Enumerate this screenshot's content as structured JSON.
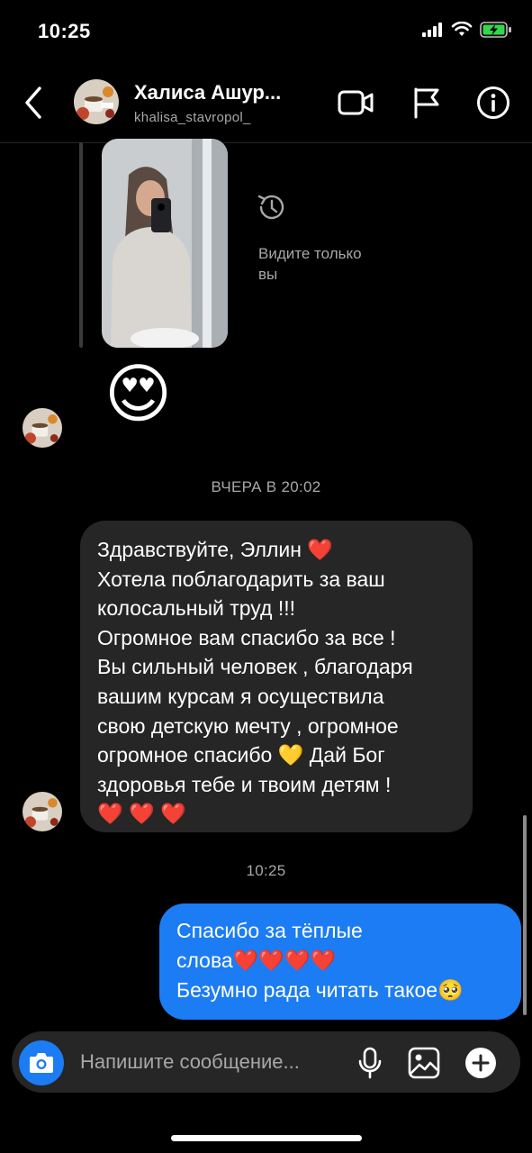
{
  "status_bar": {
    "time": "10:25"
  },
  "header": {
    "name": "Халиса Ашур...",
    "username": "khalisa_stavropol_",
    "icons": [
      "back-arrow-icon",
      "video-call-icon",
      "flag-icon",
      "info-icon"
    ]
  },
  "story_reply": {
    "visibility_note": "Видите только вы",
    "emoji": "😍"
  },
  "timestamps": {
    "yesterday": "ВЧЕРА В 20:02",
    "today": "10:25"
  },
  "incoming_message": {
    "lines": [
      "Здравствуйте,  Эллин ❤️",
      "Хотела поблагодарить  за ваш",
      "колосальный труд !!!",
      "Огромное вам спасибо за все !",
      "Вы сильный человек , благодаря",
      "вашим курсам я осуществила",
      "свою детскую мечту , огромное",
      "огромное спасибо 💛 Дай Бог",
      "здоровья тебе и твоим детям !",
      "❤️ ❤️ ❤️"
    ]
  },
  "outgoing_message": {
    "lines": [
      "Спасибо за тёплые",
      "слова❤️❤️❤️❤️",
      "Безумно рада читать такое🥺"
    ]
  },
  "composer": {
    "placeholder": "Напишите сообщение...",
    "icons": [
      "camera-icon",
      "microphone-icon",
      "gallery-icon",
      "add-icon"
    ]
  },
  "colors": {
    "accent": "#1c7cf4",
    "incoming_bubble": "#262626",
    "background": "#000000",
    "muted_text": "#a8a8a8"
  }
}
